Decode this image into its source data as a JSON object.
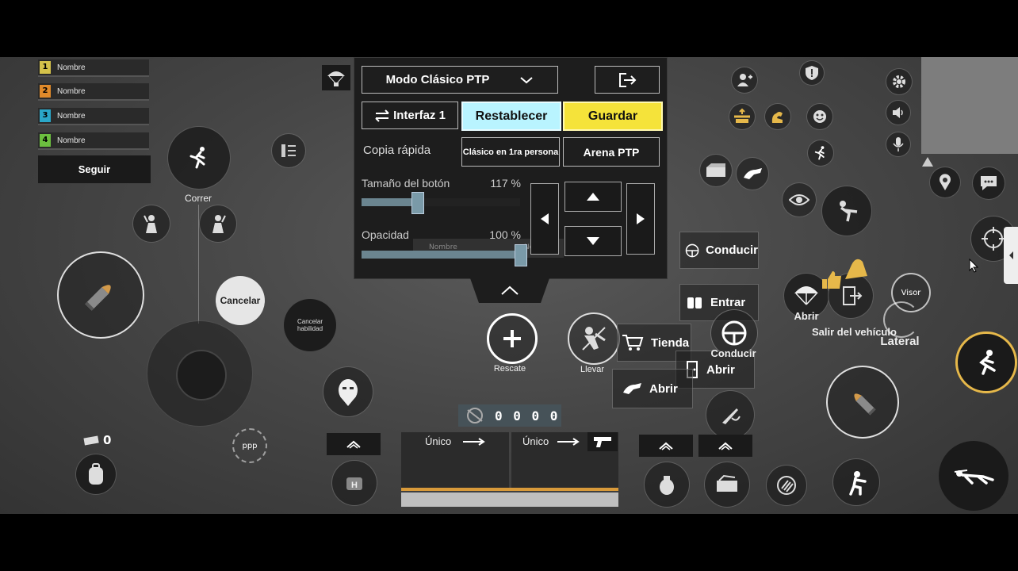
{
  "team": [
    {
      "num": "1",
      "name": "Nombre",
      "color": "#d4c24a"
    },
    {
      "num": "2",
      "name": "Nombre",
      "color": "#e08a2a"
    },
    {
      "num": "3",
      "name": "Nombre",
      "color": "#2aa7c9"
    },
    {
      "num": "4",
      "name": "Nombre",
      "color": "#6cbf3f"
    }
  ],
  "follow_label": "Seguir",
  "sprint_label": "Correr",
  "cancel_label": "Cancelar",
  "cancel_skill_label": "Cancelar habilidad",
  "ppp_label": "ppp",
  "cash_count": "0",
  "panel": {
    "mode_label": "Modo Clásico PTP",
    "interface_label": "Interfaz 1",
    "reset_label": "Restablecer",
    "save_label": "Guardar",
    "quick_copy_label": "Copia rápida",
    "preset1_label": "Clásico en 1ra persona",
    "preset2_label": "Arena PTP",
    "button_size_label": "Tamaño del botón",
    "button_size_value": "117 %",
    "button_size_fraction": 0.3,
    "opacity_label": "Opacidad",
    "opacity_value": "100 %",
    "opacity_fraction": 1.0,
    "ghost_label": "Nombre"
  },
  "rescue_label": "Rescate",
  "carry_label": "Llevar",
  "ammo_counter": "0 0 0 0",
  "weapon1_mode": "Único",
  "weapon2_mode": "Único",
  "actions": {
    "drive1": "Conducir",
    "enter": "Entrar",
    "shop": "Tienda",
    "drive2": "Conducir",
    "open_door": "Abrir",
    "open_hand": "Abrir",
    "open_chute": "Abrir",
    "exit_vehicle": "Salir del vehículo",
    "lateral": "Lateral",
    "aim": "Visor"
  },
  "colors": {
    "reset_bg": "#b9f4ff",
    "save_bg": "#f5e33a",
    "accent_gold": "#e6b84a"
  }
}
